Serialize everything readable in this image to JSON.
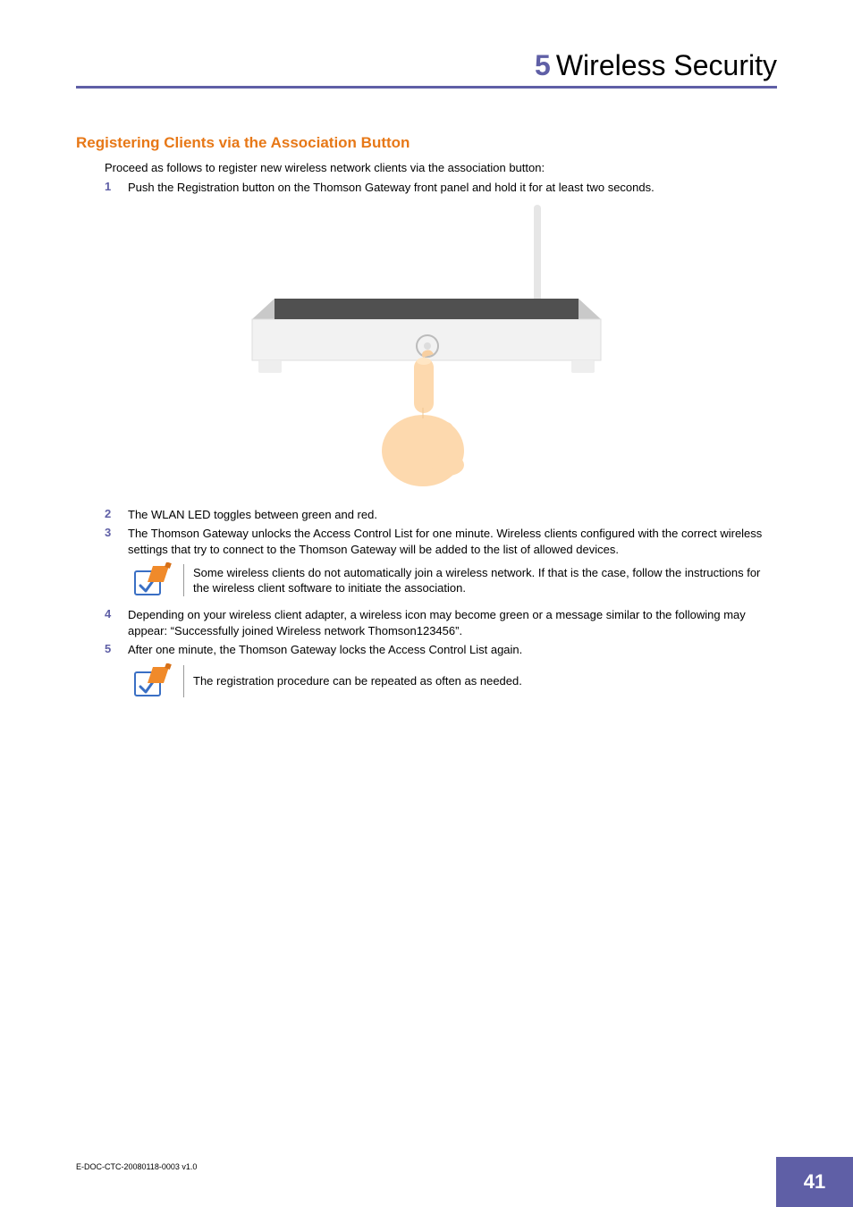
{
  "header": {
    "chapter_num": "5",
    "chapter_title": "Wireless Security"
  },
  "section": {
    "title": "Registering Clients via the Association Button",
    "intro": "Proceed as follows to register new wireless network clients via the association button:"
  },
  "steps": {
    "s1": {
      "num": "1",
      "text": "Push the Registration button on the Thomson Gateway front panel and hold it for at least two seconds."
    },
    "s2": {
      "num": "2",
      "text": "The WLAN LED toggles between green and red."
    },
    "s3": {
      "num": "3",
      "text": "The Thomson Gateway unlocks the Access Control List for one minute. Wireless clients configured with the correct wireless settings that try to connect to the Thomson Gateway will be added to the list of allowed devices."
    },
    "s4": {
      "num": "4",
      "text": "Depending on your wireless client adapter, a wireless icon may become green or a message similar to the following may appear: “Successfully joined Wireless network Thomson123456”."
    },
    "s5": {
      "num": "5",
      "text": "After one minute, the Thomson Gateway locks the Access Control List again."
    }
  },
  "notes": {
    "n1": "Some wireless clients do not automatically join a wireless network. If that is the case, follow the instructions for the wireless client software to initiate the association.",
    "n2": "The registration procedure can be repeated as often as needed."
  },
  "footer": {
    "doc": "E-DOC-CTC-20080118-0003 v1.0",
    "page": "41"
  },
  "icons": {
    "note": "note-pencil-check-icon"
  }
}
